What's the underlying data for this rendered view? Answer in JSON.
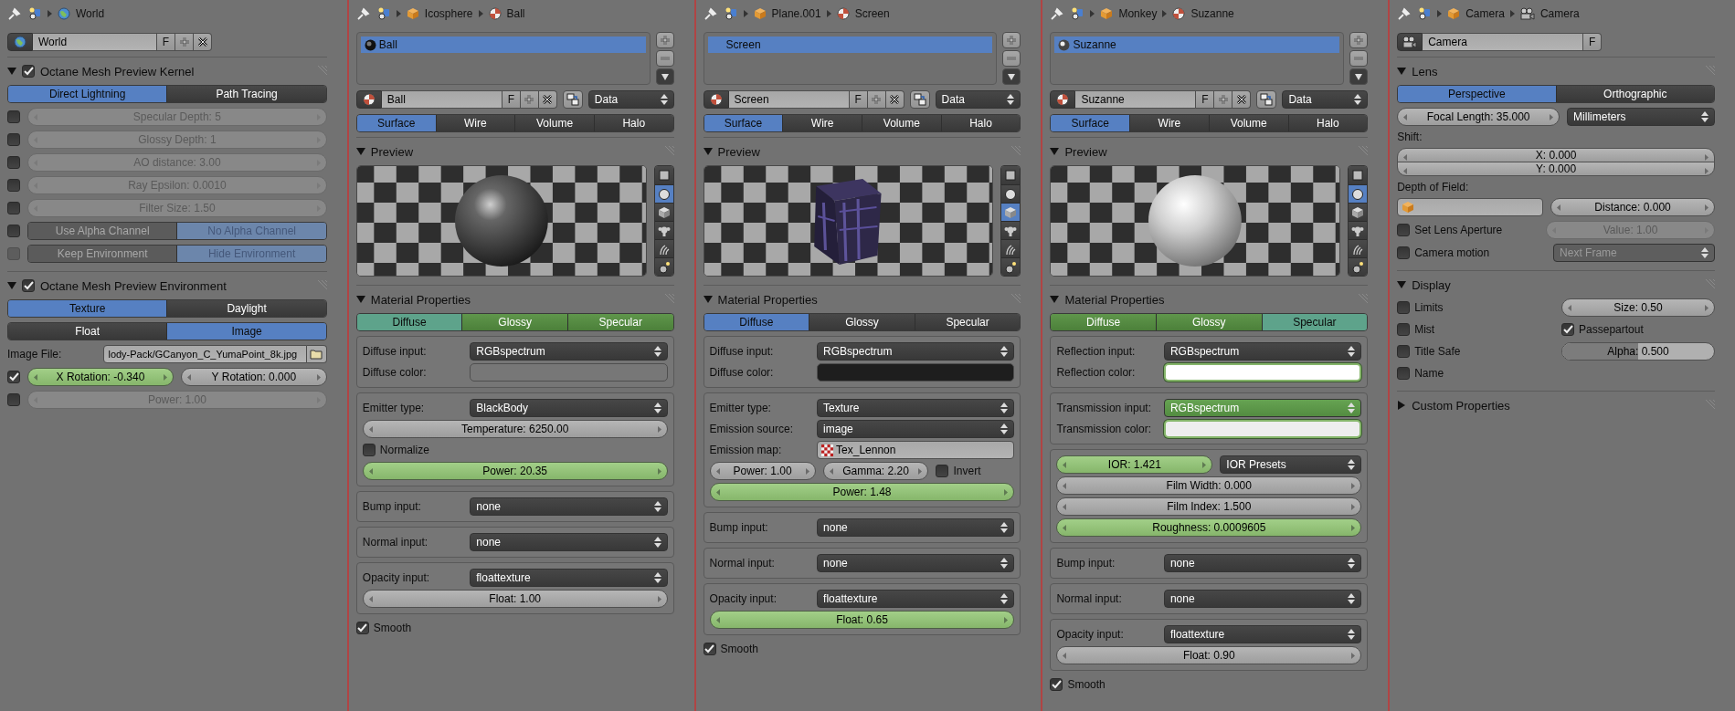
{
  "panels": [
    {
      "breadcrumb": [
        {
          "kind": "world",
          "text": "World"
        }
      ],
      "items": [
        {
          "kind": "world-block",
          "name": "World",
          "f": "F"
        },
        {
          "kind": "section",
          "title": "Octane Mesh Preview Kernel",
          "expanded": true,
          "checked": true,
          "items": [
            {
              "kind": "seg",
              "keyed": false,
              "disabled": false,
              "options": [
                {
                  "label": "Direct Lightning",
                  "selected": true
                },
                {
                  "label": "Path Tracing",
                  "selected": false
                }
              ]
            },
            {
              "kind": "row",
              "items": [
                {
                  "kind": "check",
                  "checked": false,
                  "disabled": false
                },
                {
                  "kind": "num",
                  "text": "Specular Depth: 5",
                  "keyed": false,
                  "disabled": true
                }
              ]
            },
            {
              "kind": "row",
              "items": [
                {
                  "kind": "check",
                  "checked": false,
                  "disabled": false
                },
                {
                  "kind": "num",
                  "text": "Glossy Depth: 1",
                  "keyed": false,
                  "disabled": true
                }
              ]
            },
            {
              "kind": "row",
              "items": [
                {
                  "kind": "check",
                  "checked": false,
                  "disabled": false
                },
                {
                  "kind": "num",
                  "text": "AO distance: 3.00",
                  "keyed": false,
                  "disabled": true
                }
              ]
            },
            {
              "kind": "row",
              "items": [
                {
                  "kind": "check",
                  "checked": false,
                  "disabled": false
                },
                {
                  "kind": "num",
                  "text": "Ray Epsilon: 0.0010",
                  "keyed": false,
                  "disabled": true
                }
              ]
            },
            {
              "kind": "row",
              "items": [
                {
                  "kind": "check",
                  "checked": false,
                  "disabled": false
                },
                {
                  "kind": "num",
                  "text": "Filter Size: 1.50",
                  "keyed": false,
                  "disabled": true
                }
              ]
            },
            {
              "kind": "row",
              "items": [
                {
                  "kind": "check",
                  "checked": false,
                  "disabled": false
                },
                {
                  "kind": "seg",
                  "keyed": false,
                  "disabled": true,
                  "options": [
                    {
                      "label": "Use Alpha Channel",
                      "selected": false
                    },
                    {
                      "label": "No Alpha Channel",
                      "selected": true
                    }
                  ]
                }
              ]
            },
            {
              "kind": "row",
              "items": [
                {
                  "kind": "check",
                  "checked": false,
                  "disabled": true
                },
                {
                  "kind": "seg",
                  "keyed": false,
                  "disabled": true,
                  "options": [
                    {
                      "label": "Keep Environment",
                      "selected": false
                    },
                    {
                      "label": "Hide Environment",
                      "selected": true
                    }
                  ]
                }
              ]
            }
          ]
        },
        {
          "kind": "section",
          "title": "Octane Mesh Preview Environment",
          "expanded": true,
          "checked": true,
          "items": [
            {
              "kind": "seg",
              "keyed": false,
              "disabled": false,
              "options": [
                {
                  "label": "Texture",
                  "selected": true
                },
                {
                  "label": "Daylight",
                  "selected": false
                }
              ]
            },
            {
              "kind": "seg",
              "keyed": false,
              "disabled": false,
              "options": [
                {
                  "label": "Float",
                  "selected": false
                },
                {
                  "label": "Image",
                  "selected": true
                }
              ]
            },
            {
              "kind": "prop",
              "label": "Image File:",
              "control": {
                "kind": "file",
                "value": "lody-Pack/GCanyon_C_YumaPoint_8k.jpg"
              }
            },
            {
              "kind": "row",
              "items": [
                {
                  "kind": "check",
                  "checked": true,
                  "disabled": false
                },
                {
                  "kind": "num",
                  "text": "X Rotation: -0.340",
                  "keyed": true,
                  "disabled": false
                },
                {
                  "kind": "num",
                  "text": "Y Rotation: 0.000",
                  "keyed": false,
                  "disabled": false
                }
              ]
            },
            {
              "kind": "row",
              "items": [
                {
                  "kind": "check",
                  "checked": false,
                  "disabled": false
                },
                {
                  "kind": "num",
                  "text": "Power: 1.00",
                  "keyed": false,
                  "disabled": true
                }
              ]
            }
          ]
        }
      ]
    },
    {
      "breadcrumb": [
        {
          "kind": "object",
          "text": "Icosphere"
        },
        {
          "kind": "material",
          "text": "Ball"
        }
      ],
      "items": [
        {
          "kind": "slots",
          "items": [
            {
              "kind": "dark-ball",
              "label": "Ball",
              "selected": true
            }
          ]
        },
        {
          "kind": "material-block",
          "name": "Ball",
          "f": "F",
          "menu": "Data"
        },
        {
          "kind": "seg",
          "keyed": false,
          "disabled": false,
          "options": [
            {
              "label": "Surface",
              "selected": true
            },
            {
              "label": "Wire",
              "selected": false
            },
            {
              "label": "Volume",
              "selected": false
            },
            {
              "label": "Halo",
              "selected": false
            }
          ]
        },
        {
          "kind": "section",
          "title": "Preview",
          "expanded": true,
          "items": [
            {
              "kind": "dark-sphere-preview",
              "buttons": [
                {
                  "selected": false
                },
                {
                  "selected": true
                },
                {
                  "selected": false
                },
                {
                  "selected": false
                },
                {
                  "selected": false
                },
                {
                  "selected": false
                }
              ]
            }
          ]
        },
        {
          "kind": "section",
          "title": "Material Properties",
          "expanded": true,
          "items": [
            {
              "kind": "seg",
              "keyed": true,
              "disabled": false,
              "options": [
                {
                  "label": "Diffuse",
                  "selected": true
                },
                {
                  "label": "Glossy",
                  "selected": false
                },
                {
                  "label": "Specular",
                  "selected": false
                }
              ]
            },
            {
              "kind": "box",
              "items": [
                {
                  "kind": "prop",
                  "label": "Diffuse input:",
                  "control": {
                    "kind": "menu",
                    "value": "RGBspectrum",
                    "keyed": false,
                    "disabled": false
                  }
                },
                {
                  "kind": "prop",
                  "label": "Diffuse color:",
                  "control": {
                    "kind": "color",
                    "color": "#777777",
                    "keyed": false
                  }
                }
              ]
            },
            {
              "kind": "box",
              "items": [
                {
                  "kind": "prop",
                  "label": "Emitter type:",
                  "control": {
                    "kind": "menu",
                    "value": "BlackBody",
                    "keyed": false,
                    "disabled": false
                  }
                },
                {
                  "kind": "num",
                  "text": "Temperature: 6250.00",
                  "keyed": false,
                  "disabled": false
                },
                {
                  "kind": "check",
                  "label": "Normalize",
                  "checked": false,
                  "disabled": false
                },
                {
                  "kind": "num",
                  "text": "Power: 20.35",
                  "keyed": true,
                  "disabled": false
                }
              ]
            },
            {
              "kind": "box",
              "items": [
                {
                  "kind": "prop",
                  "label": "Bump input:",
                  "control": {
                    "kind": "menu",
                    "value": "none",
                    "keyed": false,
                    "disabled": false
                  }
                }
              ]
            },
            {
              "kind": "box",
              "items": [
                {
                  "kind": "prop",
                  "label": "Normal input:",
                  "control": {
                    "kind": "menu",
                    "value": "none",
                    "keyed": false,
                    "disabled": false
                  }
                }
              ]
            },
            {
              "kind": "box",
              "items": [
                {
                  "kind": "prop",
                  "label": "Opacity input:",
                  "control": {
                    "kind": "menu",
                    "value": "floattexture",
                    "keyed": false,
                    "disabled": false
                  }
                },
                {
                  "kind": "num",
                  "text": "Float: 1.00",
                  "keyed": false,
                  "disabled": false
                }
              ]
            },
            {
              "kind": "check",
              "label": "Smooth",
              "checked": true,
              "disabled": false
            }
          ]
        }
      ]
    },
    {
      "breadcrumb": [
        {
          "kind": "object",
          "text": "Plane.001"
        },
        {
          "kind": "material",
          "text": "Screen"
        }
      ],
      "items": [
        {
          "kind": "slots",
          "items": [
            {
              "kind": "plain",
              "label": "Screen",
              "selected": true
            }
          ]
        },
        {
          "kind": "material-block",
          "name": "Screen",
          "f": "F",
          "menu": "Data"
        },
        {
          "kind": "seg",
          "keyed": false,
          "disabled": false,
          "options": [
            {
              "label": "Surface",
              "selected": true
            },
            {
              "label": "Wire",
              "selected": false
            },
            {
              "label": "Volume",
              "selected": false
            },
            {
              "label": "Halo",
              "selected": false
            }
          ]
        },
        {
          "kind": "section",
          "title": "Preview",
          "expanded": true,
          "items": [
            {
              "kind": "cube-preview",
              "buttons": [
                {
                  "selected": false
                },
                {
                  "selected": false
                },
                {
                  "selected": true
                },
                {
                  "selected": false
                },
                {
                  "selected": false
                },
                {
                  "selected": false
                }
              ]
            }
          ]
        },
        {
          "kind": "section",
          "title": "Material Properties",
          "expanded": true,
          "items": [
            {
              "kind": "seg",
              "keyed": false,
              "disabled": false,
              "options": [
                {
                  "label": "Diffuse",
                  "selected": true
                },
                {
                  "label": "Glossy",
                  "selected": false
                },
                {
                  "label": "Specular",
                  "selected": false
                }
              ]
            },
            {
              "kind": "box",
              "items": [
                {
                  "kind": "prop",
                  "label": "Diffuse input:",
                  "control": {
                    "kind": "menu",
                    "value": "RGBspectrum",
                    "keyed": false,
                    "disabled": false
                  }
                },
                {
                  "kind": "prop",
                  "label": "Diffuse color:",
                  "control": {
                    "kind": "color",
                    "color": "#1e1e1e",
                    "keyed": false
                  }
                }
              ]
            },
            {
              "kind": "box",
              "items": [
                {
                  "kind": "prop",
                  "label": "Emitter type:",
                  "control": {
                    "kind": "menu",
                    "value": "Texture",
                    "keyed": false,
                    "disabled": false
                  }
                },
                {
                  "kind": "prop",
                  "label": "Emission source:",
                  "control": {
                    "kind": "menu",
                    "value": "image",
                    "keyed": false,
                    "disabled": false
                  }
                },
                {
                  "kind": "prop",
                  "label": "Emission map:",
                  "control": {
                    "kind": "texture-field",
                    "value": "Tex_Lennon"
                  }
                },
                {
                  "kind": "row",
                  "items": [
                    {
                      "kind": "num",
                      "text": "Power: 1.00",
                      "keyed": false,
                      "disabled": false
                    },
                    {
                      "kind": "num",
                      "text": "Gamma: 2.20",
                      "keyed": false,
                      "disabled": false
                    },
                    {
                      "kind": "check",
                      "label": "Invert",
                      "checked": false,
                      "disabled": false
                    }
                  ]
                },
                {
                  "kind": "num",
                  "text": "Power: 1.48",
                  "keyed": true,
                  "disabled": false
                }
              ]
            },
            {
              "kind": "box",
              "items": [
                {
                  "kind": "prop",
                  "label": "Bump input:",
                  "control": {
                    "kind": "menu",
                    "value": "none",
                    "keyed": false,
                    "disabled": false
                  }
                }
              ]
            },
            {
              "kind": "box",
              "items": [
                {
                  "kind": "prop",
                  "label": "Normal input:",
                  "control": {
                    "kind": "menu",
                    "value": "none",
                    "keyed": false,
                    "disabled": false
                  }
                }
              ]
            },
            {
              "kind": "box",
              "items": [
                {
                  "kind": "prop",
                  "label": "Opacity input:",
                  "control": {
                    "kind": "menu",
                    "value": "floattexture",
                    "keyed": false,
                    "disabled": false
                  }
                },
                {
                  "kind": "num",
                  "text": "Float: 0.65",
                  "keyed": true,
                  "disabled": false
                }
              ]
            },
            {
              "kind": "check",
              "label": "Smooth",
              "checked": true,
              "disabled": false
            }
          ]
        }
      ]
    },
    {
      "breadcrumb": [
        {
          "kind": "object",
          "text": "Monkey"
        },
        {
          "kind": "material",
          "text": "Suzanne"
        }
      ],
      "items": [
        {
          "kind": "slots",
          "items": [
            {
              "kind": "light-ball",
              "label": "Suzanne",
              "selected": true
            }
          ]
        },
        {
          "kind": "material-block",
          "name": "Suzanne",
          "f": "F",
          "menu": "Data"
        },
        {
          "kind": "seg",
          "keyed": false,
          "disabled": false,
          "options": [
            {
              "label": "Surface",
              "selected": true
            },
            {
              "label": "Wire",
              "selected": false
            },
            {
              "label": "Volume",
              "selected": false
            },
            {
              "label": "Halo",
              "selected": false
            }
          ]
        },
        {
          "kind": "section",
          "title": "Preview",
          "expanded": true,
          "items": [
            {
              "kind": "light-sphere-preview",
              "buttons": [
                {
                  "selected": false
                },
                {
                  "selected": true
                },
                {
                  "selected": false
                },
                {
                  "selected": false
                },
                {
                  "selected": false
                },
                {
                  "selected": false
                }
              ]
            }
          ]
        },
        {
          "kind": "section",
          "title": "Material Properties",
          "expanded": true,
          "items": [
            {
              "kind": "seg",
              "keyed": true,
              "disabled": false,
              "options": [
                {
                  "label": "Diffuse",
                  "selected": false
                },
                {
                  "label": "Glossy",
                  "selected": false
                },
                {
                  "label": "Specular",
                  "selected": true
                }
              ]
            },
            {
              "kind": "box",
              "items": [
                {
                  "kind": "prop",
                  "label": "Reflection input:",
                  "control": {
                    "kind": "menu",
                    "value": "RGBspectrum",
                    "keyed": false,
                    "disabled": false
                  }
                },
                {
                  "kind": "prop",
                  "label": "Reflection color:",
                  "control": {
                    "kind": "color",
                    "color": "#ffffff",
                    "keyed": true
                  }
                }
              ]
            },
            {
              "kind": "box",
              "items": [
                {
                  "kind": "prop",
                  "label": "Transmission input:",
                  "control": {
                    "kind": "menu",
                    "value": "RGBspectrum",
                    "keyed": true,
                    "disabled": false
                  }
                },
                {
                  "kind": "prop",
                  "label": "Transmission color:",
                  "control": {
                    "kind": "color",
                    "color": "#eeeeee",
                    "keyed": true
                  }
                }
              ]
            },
            {
              "kind": "box",
              "items": [
                {
                  "kind": "row",
                  "items": [
                    {
                      "kind": "num",
                      "text": "IOR: 1.421",
                      "keyed": true,
                      "disabled": false
                    },
                    {
                      "kind": "menu",
                      "value": "IOR Presets",
                      "keyed": false,
                      "disabled": false
                    }
                  ]
                },
                {
                  "kind": "num",
                  "text": "Film Width: 0.000",
                  "keyed": false,
                  "disabled": false
                },
                {
                  "kind": "num",
                  "text": "Film Index: 1.500",
                  "keyed": false,
                  "disabled": false
                },
                {
                  "kind": "num",
                  "text": "Roughness: 0.0009605",
                  "keyed": true,
                  "disabled": false
                }
              ]
            },
            {
              "kind": "box",
              "items": [
                {
                  "kind": "prop",
                  "label": "Bump input:",
                  "control": {
                    "kind": "menu",
                    "value": "none",
                    "keyed": false,
                    "disabled": false
                  }
                }
              ]
            },
            {
              "kind": "box",
              "items": [
                {
                  "kind": "prop",
                  "label": "Normal input:",
                  "control": {
                    "kind": "menu",
                    "value": "none",
                    "keyed": false,
                    "disabled": false
                  }
                }
              ]
            },
            {
              "kind": "box",
              "items": [
                {
                  "kind": "prop",
                  "label": "Opacity input:",
                  "control": {
                    "kind": "menu",
                    "value": "floattexture",
                    "keyed": false,
                    "disabled": false
                  }
                },
                {
                  "kind": "num",
                  "text": "Float: 0.90",
                  "keyed": false,
                  "disabled": false
                }
              ]
            },
            {
              "kind": "check",
              "label": "Smooth",
              "checked": true,
              "disabled": false
            }
          ]
        }
      ]
    },
    {
      "breadcrumb": [
        {
          "kind": "object",
          "text": "Camera"
        },
        {
          "kind": "camera",
          "text": "Camera"
        }
      ],
      "items": [
        {
          "kind": "camera-block",
          "name": "Camera",
          "f": "F"
        },
        {
          "kind": "section",
          "title": "Lens",
          "expanded": true,
          "items": [
            {
              "kind": "seg",
              "keyed": false,
              "disabled": false,
              "options": [
                {
                  "label": "Perspective",
                  "selected": true
                },
                {
                  "label": "Orthographic",
                  "selected": false
                }
              ]
            },
            {
              "kind": "row",
              "items": [
                {
                  "kind": "num",
                  "text": "Focal Length: 35.000",
                  "keyed": false,
                  "disabled": false
                },
                {
                  "kind": "menu",
                  "value": "Millimeters",
                  "keyed": false,
                  "disabled": false
                }
              ]
            },
            {
              "kind": "label",
              "text": "Shift:"
            },
            {
              "kind": "stack",
              "items": [
                {
                  "kind": "num",
                  "text": "X: 0.000",
                  "keyed": false,
                  "disabled": false
                },
                {
                  "kind": "num",
                  "text": "Y: 0.000",
                  "keyed": false,
                  "disabled": false
                }
              ]
            },
            {
              "kind": "label",
              "text": "Depth of Field:"
            },
            {
              "kind": "row",
              "items": [
                {
                  "kind": "object-field"
                },
                {
                  "kind": "num",
                  "text": "Distance: 0.000",
                  "keyed": false,
                  "disabled": false
                }
              ]
            },
            {
              "kind": "row",
              "items": [
                {
                  "kind": "check",
                  "label": "Set Lens Aperture",
                  "checked": false,
                  "disabled": false
                },
                {
                  "kind": "num",
                  "text": "Value: 1.00",
                  "keyed": false,
                  "disabled": true
                }
              ]
            },
            {
              "kind": "row",
              "items": [
                {
                  "kind": "check",
                  "label": "Camera motion",
                  "checked": false,
                  "disabled": false
                },
                {
                  "kind": "menu",
                  "value": "Next Frame",
                  "keyed": false,
                  "disabled": true
                }
              ]
            }
          ]
        },
        {
          "kind": "section",
          "title": "Display",
          "expanded": true,
          "items": [
            {
              "kind": "columns",
              "columns": [
                [
                  {
                    "kind": "check",
                    "label": "Limits",
                    "checked": false,
                    "disabled": false
                  },
                  {
                    "kind": "check",
                    "label": "Mist",
                    "checked": false,
                    "disabled": false
                  },
                  {
                    "kind": "check",
                    "label": "Title Safe",
                    "checked": false,
                    "disabled": false
                  },
                  {
                    "kind": "check",
                    "label": "Name",
                    "checked": false,
                    "disabled": false
                  }
                ],
                [
                  {
                    "kind": "num",
                    "text": "Size: 0.50",
                    "keyed": false,
                    "disabled": false
                  },
                  {
                    "kind": "check",
                    "label": "Passepartout",
                    "checked": true,
                    "disabled": false
                  },
                  {
                    "kind": "slider",
                    "text": "Alpha: 0.500",
                    "level": 0.5
                  }
                ]
              ]
            }
          ]
        },
        {
          "kind": "section",
          "title": "Custom Properties",
          "expanded": false
        }
      ]
    }
  ]
}
